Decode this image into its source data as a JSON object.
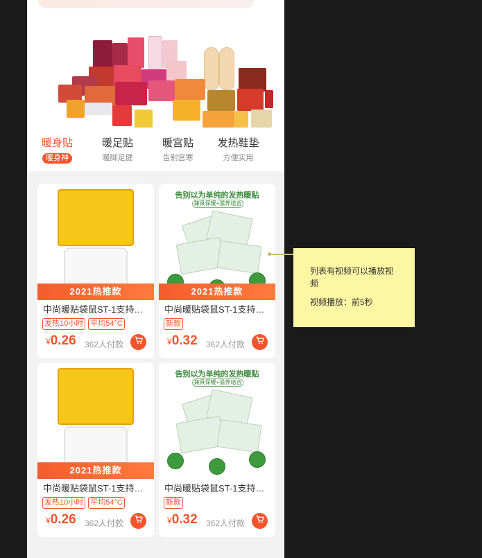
{
  "categories": [
    {
      "title": "暖身贴",
      "subtitle": "暖身神",
      "active": true
    },
    {
      "title": "暖足贴",
      "subtitle": "暖脚足健",
      "active": false
    },
    {
      "title": "暖宫贴",
      "subtitle": "告别宫寒",
      "active": false
    },
    {
      "title": "发热鞋垫",
      "subtitle": "方便实用",
      "active": false
    }
  ],
  "products": [
    {
      "banner": "2021热推款",
      "title": "中尚暖贴袋鼠ST-1支持件...",
      "tags": [
        "发热10小时",
        "平均54°C"
      ],
      "price_symbol": "¥",
      "price": "0.26",
      "sold": "362人付款",
      "image": "yellow-pack"
    },
    {
      "banner": "2021热推款",
      "title": "中尚暖贴袋鼠ST-1支持件...",
      "tags": [
        "新款"
      ],
      "price_symbol": "¥",
      "price": "0.32",
      "sold": "362人付款",
      "image": "green-pack",
      "image_text": {
        "headline": "告别以为单纯的发热暖贴",
        "sub": "兼具保暖+滋养结合"
      }
    },
    {
      "banner": "2021热推款",
      "title": "中尚暖贴袋鼠ST-1支持件...",
      "tags": [
        "发热10小时",
        "平均54°C"
      ],
      "price_symbol": "¥",
      "price": "0.26",
      "sold": "362人付款",
      "image": "yellow-pack"
    },
    {
      "banner": "",
      "title": "中尚暖贴袋鼠ST-1支持件...",
      "tags": [
        "新款"
      ],
      "price_symbol": "¥",
      "price": "0.32",
      "sold": "362人付款",
      "image": "green-pack",
      "image_text": {
        "headline": "告别以为单纯的发热暖贴",
        "sub": "兼具保暖+滋养结合"
      }
    }
  ],
  "annotation": {
    "line1": "列表有视频可以播放视频",
    "line2": "视频播放：前5秒"
  },
  "colors": {
    "accent": "#f0552d",
    "note": "#fdf7a4"
  },
  "icons": {
    "cart": "cart-icon"
  }
}
